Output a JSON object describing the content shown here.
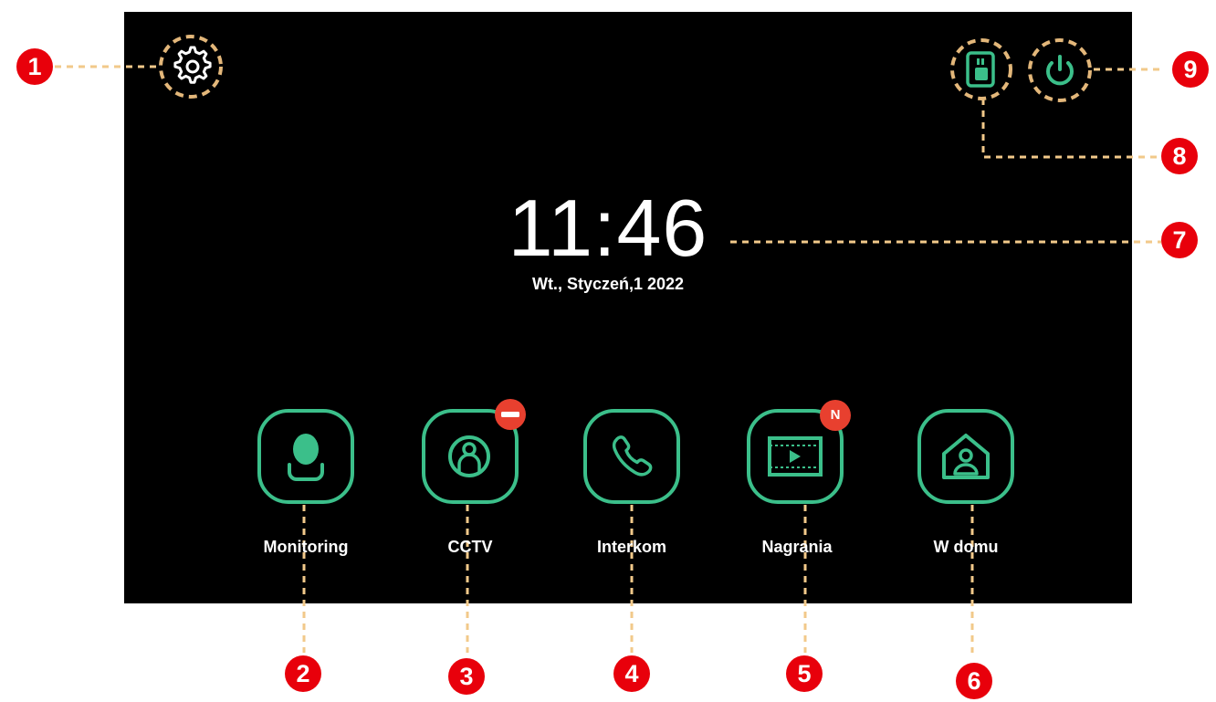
{
  "clock": {
    "time": "11:46",
    "date": "Wt., Styczeń,1 2022"
  },
  "apps": [
    {
      "label": "Monitoring",
      "icon": "monitoring-person-icon",
      "callout": "2"
    },
    {
      "label": "CCTV",
      "icon": "cctv-camera-person-icon",
      "callout": "3",
      "badge": "remove"
    },
    {
      "label": "Interkom",
      "icon": "phone-handset-icon",
      "callout": "4"
    },
    {
      "label": "Nagrania",
      "icon": "film-play-icon",
      "callout": "5",
      "badge_text": "N"
    },
    {
      "label": "W domu",
      "icon": "home-person-icon",
      "callout": "6"
    }
  ],
  "callouts": {
    "settings": "1",
    "clock": "7",
    "sd_card": "8",
    "power": "9"
  },
  "icons": {
    "settings": "gear-icon",
    "sd_card": "sd-card-icon",
    "power": "power-icon"
  },
  "colors": {
    "accent": "#3bbf8a",
    "callout": "#e8000b",
    "leader_line": "#f2c98a",
    "screen": "#000000",
    "badge": "#e8402f"
  }
}
